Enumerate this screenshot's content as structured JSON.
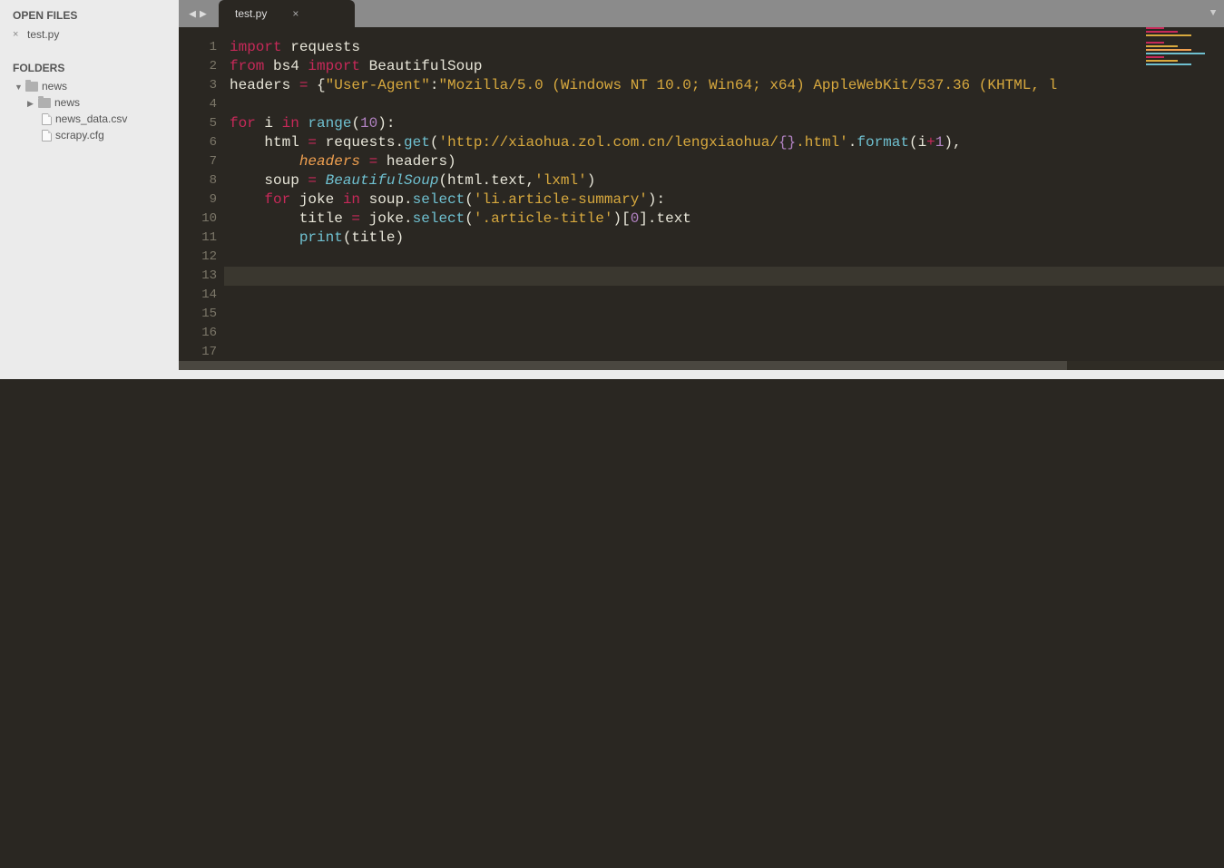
{
  "sidebar": {
    "open_files_header": "OPEN FILES",
    "open_files": [
      {
        "name": "test.py"
      }
    ],
    "folders_header": "FOLDERS",
    "tree": {
      "root": "news",
      "child_folder": "news",
      "files": [
        "news_data.csv",
        "scrapy.cfg"
      ]
    }
  },
  "tabs": {
    "active": "test.py"
  },
  "gutter": {
    "start": 1,
    "end": 17,
    "highlighted": 13
  },
  "code": {
    "lines": [
      [
        {
          "t": "import ",
          "c": "kw"
        },
        {
          "t": "requests",
          "c": "var"
        }
      ],
      [
        {
          "t": "from ",
          "c": "kw"
        },
        {
          "t": "bs4 ",
          "c": "var"
        },
        {
          "t": "import ",
          "c": "kw"
        },
        {
          "t": "BeautifulSoup",
          "c": "var"
        }
      ],
      [
        {
          "t": "headers ",
          "c": "var"
        },
        {
          "t": "= ",
          "c": "op"
        },
        {
          "t": "{",
          "c": "brace"
        },
        {
          "t": "\"User-Agent\"",
          "c": "str"
        },
        {
          "t": ":",
          "c": "var"
        },
        {
          "t": "\"Mozilla/5.0 (Windows NT 10.0; Win64; x64) AppleWebKit/537.36 (KHTML, l",
          "c": "str"
        }
      ],
      [],
      [
        {
          "t": "for ",
          "c": "kw"
        },
        {
          "t": "i ",
          "c": "var"
        },
        {
          "t": "in ",
          "c": "kw"
        },
        {
          "t": "range",
          "c": "fn"
        },
        {
          "t": "(",
          "c": "var"
        },
        {
          "t": "10",
          "c": "num"
        },
        {
          "t": "):",
          "c": "var"
        }
      ],
      [
        {
          "t": "    html ",
          "c": "var"
        },
        {
          "t": "= ",
          "c": "op"
        },
        {
          "t": "requests.",
          "c": "var"
        },
        {
          "t": "get",
          "c": "fn"
        },
        {
          "t": "(",
          "c": "var"
        },
        {
          "t": "'http://xiaohua.zol.com.cn/lengxiaohua/",
          "c": "str"
        },
        {
          "t": "{}",
          "c": "num"
        },
        {
          "t": ".html'",
          "c": "str"
        },
        {
          "t": ".",
          "c": "var"
        },
        {
          "t": "format",
          "c": "fn"
        },
        {
          "t": "(i",
          "c": "var"
        },
        {
          "t": "+",
          "c": "op"
        },
        {
          "t": "1",
          "c": "num"
        },
        {
          "t": "),",
          "c": "var"
        }
      ],
      [
        {
          "t": "        ",
          "c": "var"
        },
        {
          "t": "headers",
          "c": "param-i"
        },
        {
          "t": " = ",
          "c": "op"
        },
        {
          "t": "headers)",
          "c": "var"
        }
      ],
      [
        {
          "t": "    soup ",
          "c": "var"
        },
        {
          "t": "= ",
          "c": "op"
        },
        {
          "t": "BeautifulSoup",
          "c": "cls"
        },
        {
          "t": "(html.text,",
          "c": "var"
        },
        {
          "t": "'lxml'",
          "c": "str"
        },
        {
          "t": ")",
          "c": "var"
        }
      ],
      [
        {
          "t": "    ",
          "c": "var"
        },
        {
          "t": "for ",
          "c": "kw"
        },
        {
          "t": "joke ",
          "c": "var"
        },
        {
          "t": "in ",
          "c": "kw"
        },
        {
          "t": "soup.",
          "c": "var"
        },
        {
          "t": "select",
          "c": "fn"
        },
        {
          "t": "(",
          "c": "var"
        },
        {
          "t": "'li.article-summary'",
          "c": "str"
        },
        {
          "t": "):",
          "c": "var"
        }
      ],
      [
        {
          "t": "        title ",
          "c": "var"
        },
        {
          "t": "= ",
          "c": "op"
        },
        {
          "t": "joke.",
          "c": "var"
        },
        {
          "t": "select",
          "c": "fn"
        },
        {
          "t": "(",
          "c": "var"
        },
        {
          "t": "'.article-title'",
          "c": "str"
        },
        {
          "t": ")[",
          "c": "var"
        },
        {
          "t": "0",
          "c": "num"
        },
        {
          "t": "].text",
          "c": "var"
        }
      ],
      [
        {
          "t": "        ",
          "c": "var"
        },
        {
          "t": "print",
          "c": "fn"
        },
        {
          "t": "(title)",
          "c": "var"
        }
      ],
      [],
      [],
      [],
      [],
      [],
      []
    ]
  },
  "minimap_colors": [
    "#c72959",
    "#c72959",
    "#d8a93e",
    "#2a2722",
    "#c72959",
    "#d8a93e",
    "#f0a050",
    "#6fc0d0",
    "#c72959",
    "#d8a93e",
    "#6fc0d0"
  ]
}
